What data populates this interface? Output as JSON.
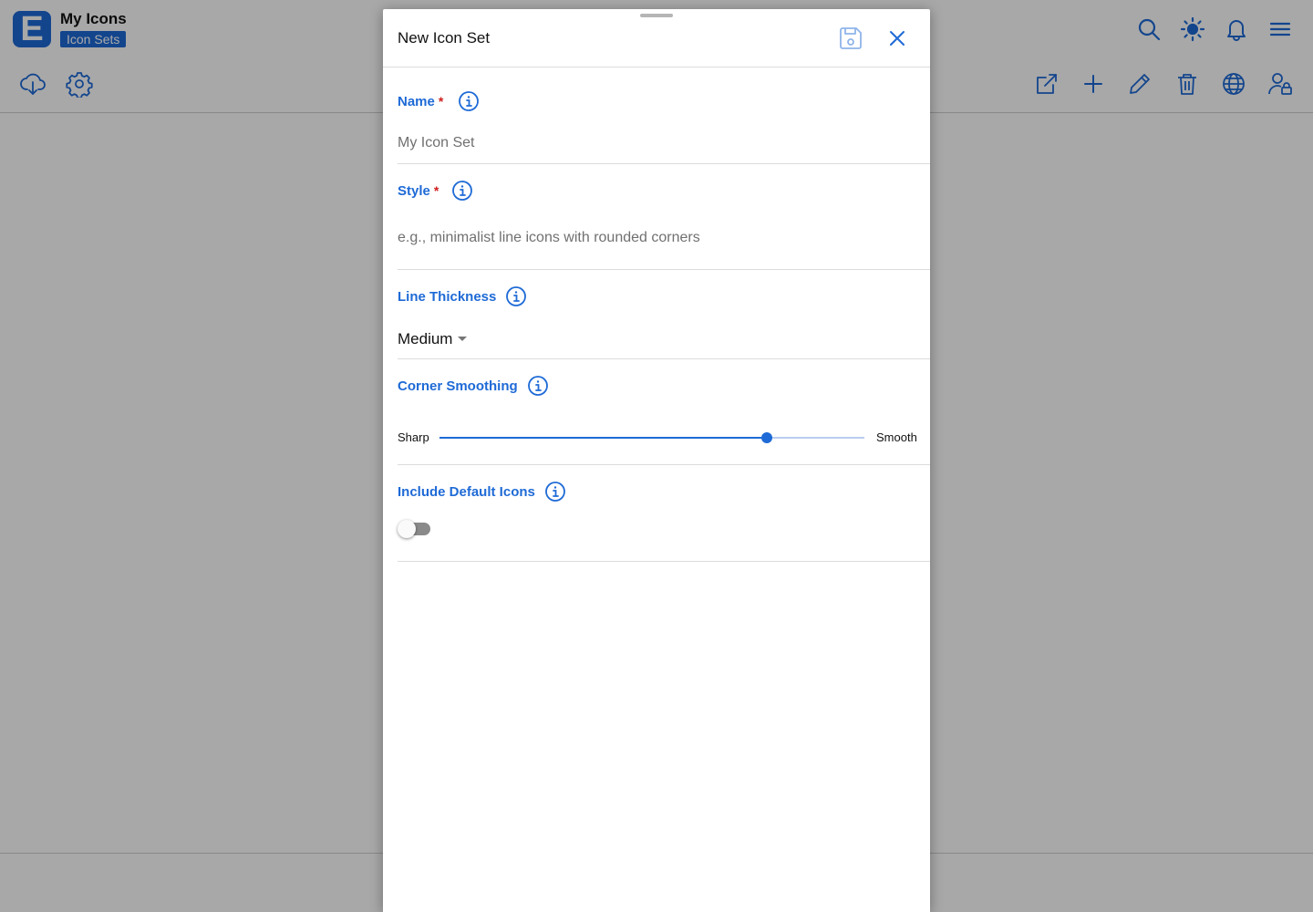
{
  "app": {
    "title": "My Icons",
    "badge": "Icon Sets",
    "logo_letter": "E",
    "accent_color": "#1e6ad6"
  },
  "header_icons": [
    "search-icon",
    "brightness-icon",
    "bell-icon",
    "menu-icon"
  ],
  "toolbar_left_icons": [
    "cloud-download-icon",
    "gear-icon"
  ],
  "toolbar_right_icons": [
    "external-link-icon",
    "plus-icon",
    "pencil-icon",
    "trash-icon",
    "globe-icon",
    "user-lock-icon"
  ],
  "modal": {
    "title": "New Icon Set",
    "save_icon": "save-icon",
    "close_icon": "close-icon",
    "fields": {
      "name": {
        "label": "Name",
        "required_mark": "*",
        "value": "",
        "placeholder": "My Icon Set"
      },
      "style": {
        "label": "Style",
        "required_mark": "*",
        "value": "",
        "placeholder": "e.g., minimalist line icons with rounded corners"
      },
      "line_thickness": {
        "label": "Line Thickness",
        "selected": "Medium"
      },
      "corner_smoothing": {
        "label": "Corner Smoothing",
        "min_label": "Sharp",
        "max_label": "Smooth",
        "value_fraction": 0.77
      },
      "include_default_icons": {
        "label": "Include Default Icons",
        "checked": false
      }
    }
  }
}
